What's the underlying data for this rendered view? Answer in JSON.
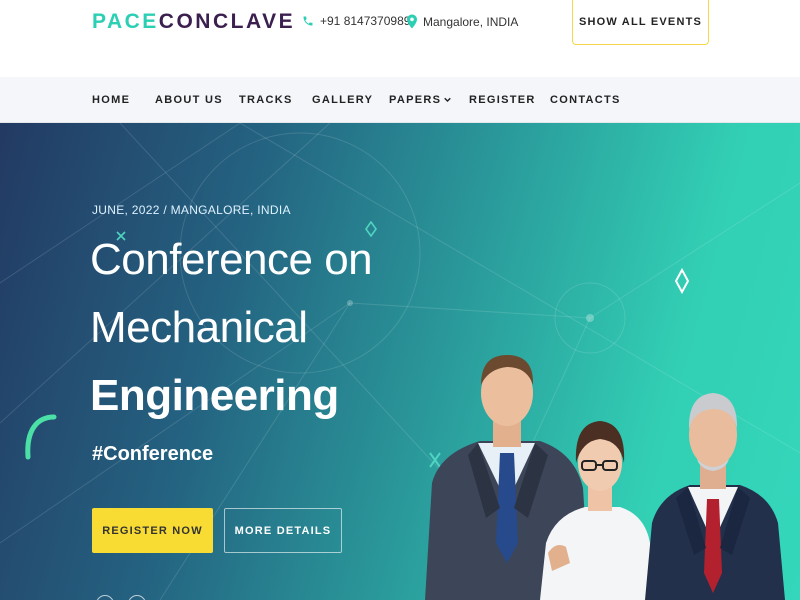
{
  "header": {
    "logo_part1": "PACE",
    "logo_part2": "CONCLAVE",
    "phone": "+91 8147370989",
    "location": "Mangalore, INDIA",
    "show_all_events": "SHOW ALL EVENTS"
  },
  "nav": {
    "items": [
      {
        "label": "HOME"
      },
      {
        "label": "ABOUT US"
      },
      {
        "label": "TRACKS"
      },
      {
        "label": "GALLERY"
      },
      {
        "label": "PAPERS"
      },
      {
        "label": "REGISTER"
      },
      {
        "label": "CONTACTS"
      }
    ]
  },
  "hero": {
    "kicker": "JUNE, 2022 / MANGALORE, INDIA",
    "title_line1": "Conference on",
    "title_line2": "Mechanical",
    "title_line3": "Engineering",
    "hashtag": "#Conference",
    "register_label": "REGISTER NOW",
    "more_label": "MORE DETAILS"
  },
  "colors": {
    "accent_teal": "#2ccfb4",
    "brand_dark": "#3a1f4f",
    "button_yellow": "#f9dc33",
    "hero_start": "#233a63",
    "hero_end": "#34d7bb"
  },
  "icons": [
    "phone-icon",
    "location-pin-icon",
    "chevron-down-icon"
  ]
}
